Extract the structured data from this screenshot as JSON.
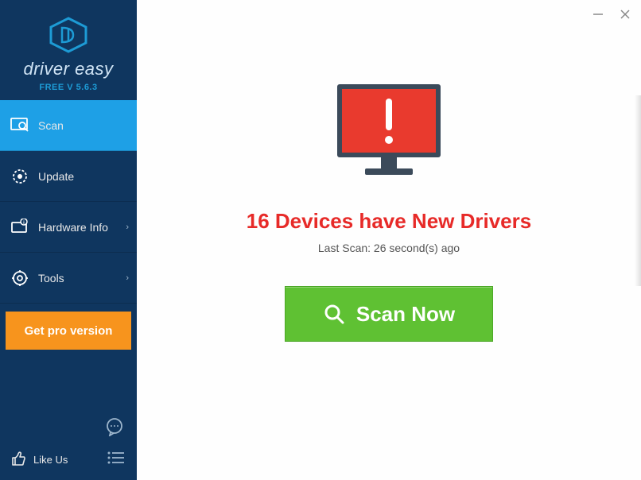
{
  "app": {
    "name": "driver easy",
    "version_label": "FREE V 5.6.3"
  },
  "sidebar": {
    "items": [
      {
        "label": "Scan",
        "has_chevron": false,
        "active": true
      },
      {
        "label": "Update",
        "has_chevron": false,
        "active": false
      },
      {
        "label": "Hardware Info",
        "has_chevron": true,
        "active": false
      },
      {
        "label": "Tools",
        "has_chevron": true,
        "active": false
      }
    ],
    "pro_button": "Get pro version",
    "like_label": "Like Us"
  },
  "main": {
    "headline": "16 Devices have New Drivers",
    "subtext": "Last Scan: 26 second(s) ago",
    "scan_button": "Scan Now"
  },
  "colors": {
    "sidebar_bg": "#0f365f",
    "active_bg": "#1ea0e6",
    "pro_bg": "#f7941d",
    "scan_bg": "#5fc133",
    "alert_red": "#e72a28"
  }
}
